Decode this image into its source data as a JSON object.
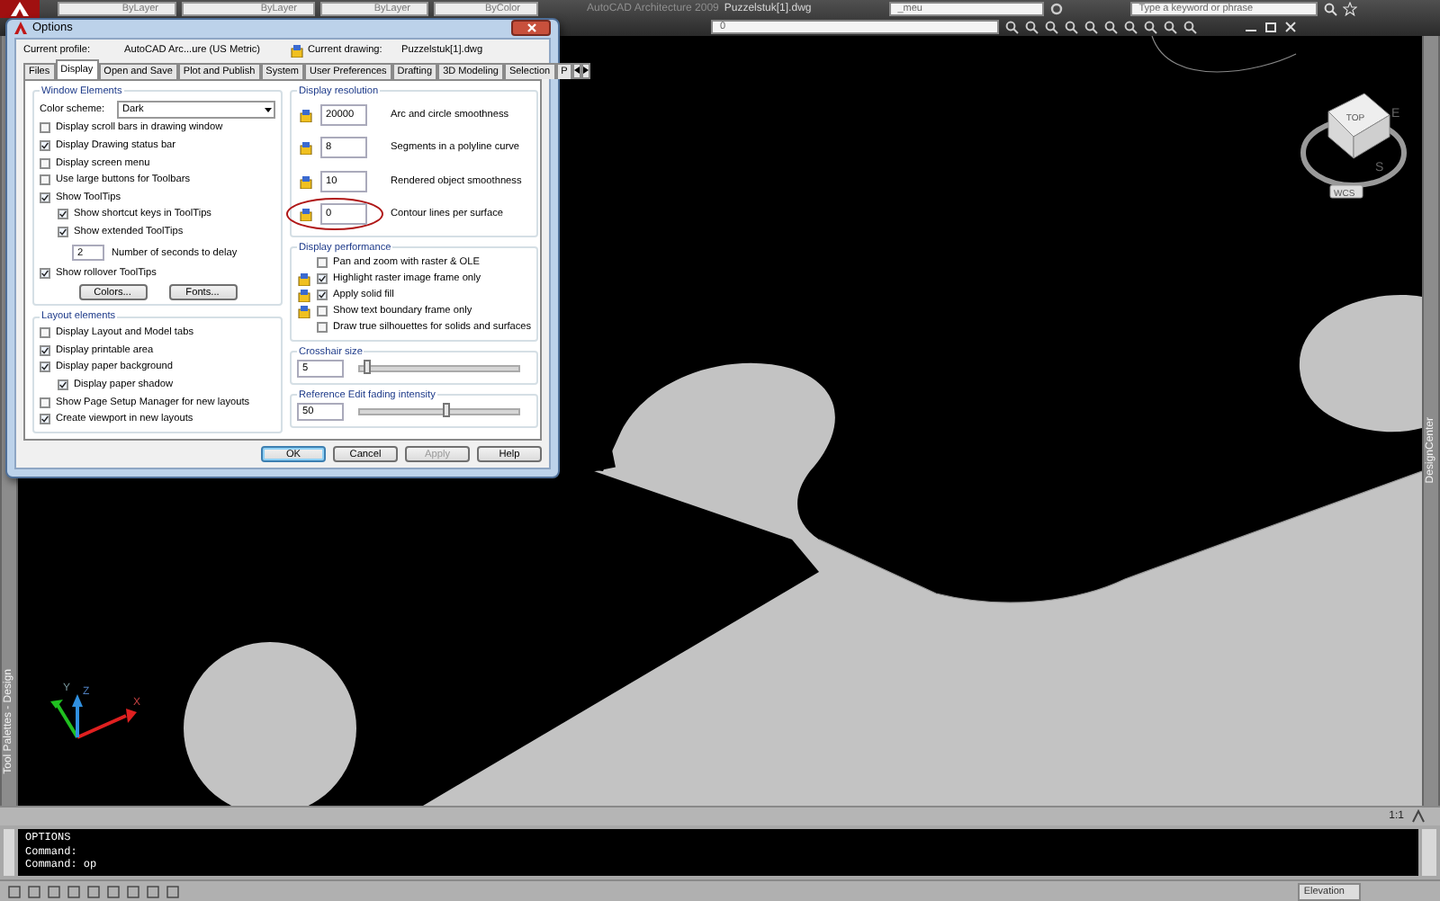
{
  "toolbar": {
    "properties": [
      "ByLayer",
      "ByLayer",
      "ByLayer",
      "ByColor"
    ],
    "app_title": "AutoCAD Architecture 2009",
    "document": "Puzzelstuk[1].dwg",
    "workspace": "_meu",
    "search": {
      "placeholder": "Type a keyword or phrase"
    },
    "layer": "0"
  },
  "palettes": {
    "left": "Tool Palettes - Design",
    "right": "DesignCenter"
  },
  "viewcube": {
    "face": "TOP",
    "compass": [
      "E",
      "S"
    ],
    "ucs": "WCS"
  },
  "ucs_icon": {
    "axes": [
      "X",
      "Y",
      "Z"
    ]
  },
  "dialog": {
    "title": "Options",
    "profile_label": "Current profile:",
    "profile": "AutoCAD Arc...ure (US Metric)",
    "drawing_label": "Current drawing:",
    "drawing": "Puzzelstuk[1].dwg",
    "tabs": [
      {
        "label": "Files",
        "selected": false
      },
      {
        "label": "Display",
        "selected": true
      },
      {
        "label": "Open and Save",
        "selected": false
      },
      {
        "label": "Plot and Publish",
        "selected": false
      },
      {
        "label": "System",
        "selected": false
      },
      {
        "label": "User Preferences",
        "selected": false
      },
      {
        "label": "Drafting",
        "selected": false
      },
      {
        "label": "3D Modeling",
        "selected": false
      },
      {
        "label": "Selection",
        "selected": false
      },
      {
        "label": "P",
        "selected": false
      }
    ],
    "window_elements": {
      "title": "Window Elements",
      "color_scheme_label": "Color scheme:",
      "color_scheme": "Dark",
      "options": [
        {
          "kind": "checkbox",
          "label": "Display scroll bars in drawing window",
          "checked": false
        },
        {
          "kind": "checkbox",
          "label": "Display Drawing status bar",
          "checked": true
        },
        {
          "kind": "checkbox",
          "label": "Display screen menu",
          "checked": false
        },
        {
          "kind": "checkbox",
          "label": "Use large buttons for Toolbars",
          "checked": false
        },
        {
          "kind": "checkbox",
          "label": "Show ToolTips",
          "checked": true,
          "children": [
            {
              "kind": "checkbox",
              "label": "Show shortcut keys in ToolTips",
              "checked": true
            },
            {
              "kind": "checkbox",
              "label": "Show extended ToolTips",
              "checked": true
            },
            {
              "kind": "number",
              "value": "2",
              "label": "Number of seconds to delay"
            }
          ]
        },
        {
          "kind": "checkbox",
          "label": "Show rollover ToolTips",
          "checked": true
        }
      ],
      "buttons": [
        "Colors...",
        "Fonts..."
      ]
    },
    "layout_elements": {
      "title": "Layout elements",
      "options": [
        {
          "kind": "checkbox",
          "label": "Display Layout and Model tabs",
          "checked": false
        },
        {
          "kind": "checkbox",
          "label": "Display printable area",
          "checked": true
        },
        {
          "kind": "checkbox",
          "label": "Display paper background",
          "checked": true,
          "children": [
            {
              "kind": "checkbox",
              "label": "Display paper shadow",
              "checked": true
            }
          ]
        },
        {
          "kind": "checkbox",
          "label": "Show Page Setup Manager for new layouts",
          "checked": false
        },
        {
          "kind": "checkbox",
          "label": "Create viewport in new layouts",
          "checked": true
        }
      ]
    },
    "display_resolution": {
      "title": "Display resolution",
      "items": [
        {
          "value": "20000",
          "label": "Arc and circle smoothness",
          "circled": false
        },
        {
          "value": "8",
          "label": "Segments in a polyline curve",
          "circled": false
        },
        {
          "value": "10",
          "label": "Rendered object smoothness",
          "circled": false
        },
        {
          "value": "0",
          "label": "Contour lines per surface",
          "circled": true
        }
      ]
    },
    "display_performance": {
      "title": "Display performance",
      "items": [
        {
          "label": "Pan and zoom with raster & OLE",
          "checked": false,
          "saved_in_drawing": false
        },
        {
          "label": "Highlight raster image frame only",
          "checked": true,
          "saved_in_drawing": true
        },
        {
          "label": "Apply solid fill",
          "checked": true,
          "saved_in_drawing": true
        },
        {
          "label": "Show text boundary frame only",
          "checked": false,
          "saved_in_drawing": true
        },
        {
          "label": "Draw true silhouettes for solids and surfaces",
          "checked": false,
          "saved_in_drawing": false
        }
      ]
    },
    "crosshair": {
      "title": "Crosshair size",
      "value": "5",
      "level": 0.05
    },
    "fading": {
      "title": "Reference Edit fading intensity",
      "value": "50",
      "level": 0.55
    },
    "buttons": [
      {
        "label": "OK",
        "default": true,
        "disabled": false
      },
      {
        "label": "Cancel",
        "default": false,
        "disabled": false
      },
      {
        "label": "Apply",
        "default": false,
        "disabled": true
      },
      {
        "label": "Help",
        "default": false,
        "disabled": false
      }
    ]
  },
  "status_bar": {
    "annotation_scale": "1:1"
  },
  "command_line": {
    "lines": [
      "OPTIONS",
      "Command:",
      "Command: op"
    ]
  },
  "bottom_bar": {
    "workspace_field": "Elevation"
  }
}
